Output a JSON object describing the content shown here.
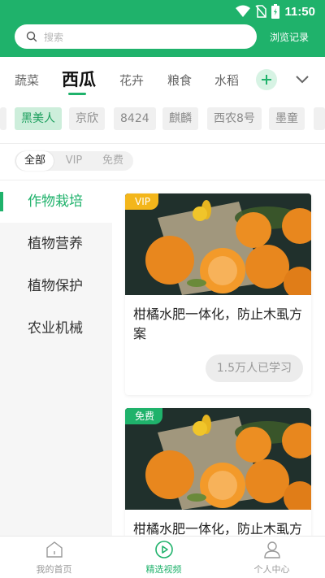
{
  "status_bar": {
    "time": "11:50"
  },
  "header": {
    "search_placeholder": "搜索",
    "history_label": "浏览记录"
  },
  "categories": {
    "items": [
      "蔬菜",
      "西瓜",
      "花卉",
      "粮食",
      "水稻"
    ],
    "active_index": 1
  },
  "varieties": {
    "items": [
      "黑美人",
      "京欣",
      "8424",
      "麒麟",
      "西农8号",
      "墨童"
    ],
    "active_index": 0
  },
  "filters": {
    "items": [
      "全部",
      "VIP",
      "免费"
    ],
    "active_index": 0
  },
  "sidenav": {
    "items": [
      "作物栽培",
      "植物营养",
      "植物保护",
      "农业机械"
    ],
    "active_index": 0
  },
  "cards": [
    {
      "badge": "VIP",
      "title": "柑橘水肥一体化，防止木虱方案",
      "learners": "1.5万人已学习"
    },
    {
      "badge": "免费",
      "title": "柑橘水肥一体化，防止木虱方案"
    }
  ],
  "bottom_nav": {
    "items": [
      "我的首页",
      "精选视频",
      "个人中心"
    ],
    "active_index": 1
  },
  "colors": {
    "brand_green": "#1fb26b",
    "vip_yellow": "#f3b61b",
    "chip_active_bg": "#cdeedb"
  },
  "icons": [
    "wifi-icon",
    "no-sim-icon",
    "battery-icon",
    "search-icon",
    "plus-icon",
    "chevron-down-icon",
    "home-icon",
    "play-circle-icon",
    "person-icon"
  ]
}
